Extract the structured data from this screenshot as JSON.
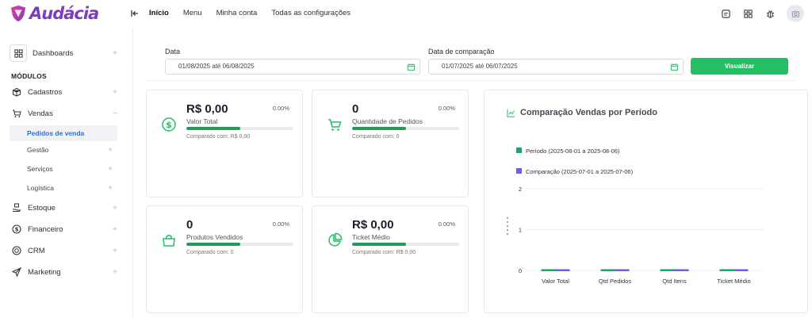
{
  "brand": {
    "name": "Audácia",
    "accent": "#7c3fb8"
  },
  "topnav": {
    "items": [
      "Início",
      "Menu",
      "Minha conta",
      "Todas as configurações"
    ]
  },
  "top_icons": [
    "notes-icon",
    "apps-grid-icon",
    "bug-icon",
    "avatar-icon"
  ],
  "sidebar": {
    "dashboards_label": "Dashboards",
    "section_label": "MÓDULOS",
    "items": [
      {
        "label": "Cadastros",
        "icon": "box-icon"
      },
      {
        "label": "Vendas",
        "icon": "cart-icon"
      },
      {
        "label": "Estoque",
        "icon": "hand-box-icon"
      },
      {
        "label": "Financeiro",
        "icon": "dollar-circle-icon"
      },
      {
        "label": "CRM",
        "icon": "target-icon"
      },
      {
        "label": "Marketing",
        "icon": "paper-plane-icon"
      }
    ],
    "vendas_sub": [
      "Pedidos de venda",
      "Gestão",
      "Serviços",
      "Logística"
    ]
  },
  "filters": {
    "date_label": "Data",
    "date_value": "01/08/2025 até 06/08/2025",
    "compare_label": "Data de comparação",
    "compare_value": "01/07/2025 até 06/07/2025",
    "button_label": "Visualizar",
    "button_color": "#22c062"
  },
  "kpis": [
    {
      "value": "R$ 0,00",
      "pct": "0.00%",
      "label": "Valor Total",
      "compared": "Comparado com: R$ 0,00",
      "progress": 0.5,
      "icon": "dollar-circle-icon"
    },
    {
      "value": "0",
      "pct": "0.00%",
      "label": "Quantidade de Pedidos",
      "compared": "Comparado com: 0",
      "progress": 0.5,
      "icon": "cart-icon"
    },
    {
      "value": "0",
      "pct": "0.00%",
      "label": "Produtos Vendidos",
      "compared": "Comparado com: 0",
      "progress": 0.5,
      "icon": "bag-icon"
    },
    {
      "value": "R$ 0,00",
      "pct": "0.00%",
      "label": "Ticket Médio",
      "compared": "Comparado com: R$ 0,00",
      "progress": 0.5,
      "icon": "pie-chart-icon"
    }
  ],
  "chart_data": {
    "type": "bar",
    "title": "Comparação Vendas por Período",
    "categories": [
      "Valor Total",
      "Qtd Pedidos",
      "Qtd Itens",
      "Ticket Médio"
    ],
    "series": [
      {
        "name": "Período (2025-08-01 a 2025-08-06)",
        "values": [
          0,
          0,
          0,
          0
        ],
        "color": "#16a86a"
      },
      {
        "name": "Comparação (2025-07-01 a 2025-07-06)",
        "values": [
          0,
          0,
          0,
          0
        ],
        "color": "#6b5de8"
      }
    ],
    "ylim": [
      0,
      2
    ],
    "yticks": [
      "0",
      "1",
      "2"
    ],
    "grid": true,
    "legend": "top-left"
  }
}
